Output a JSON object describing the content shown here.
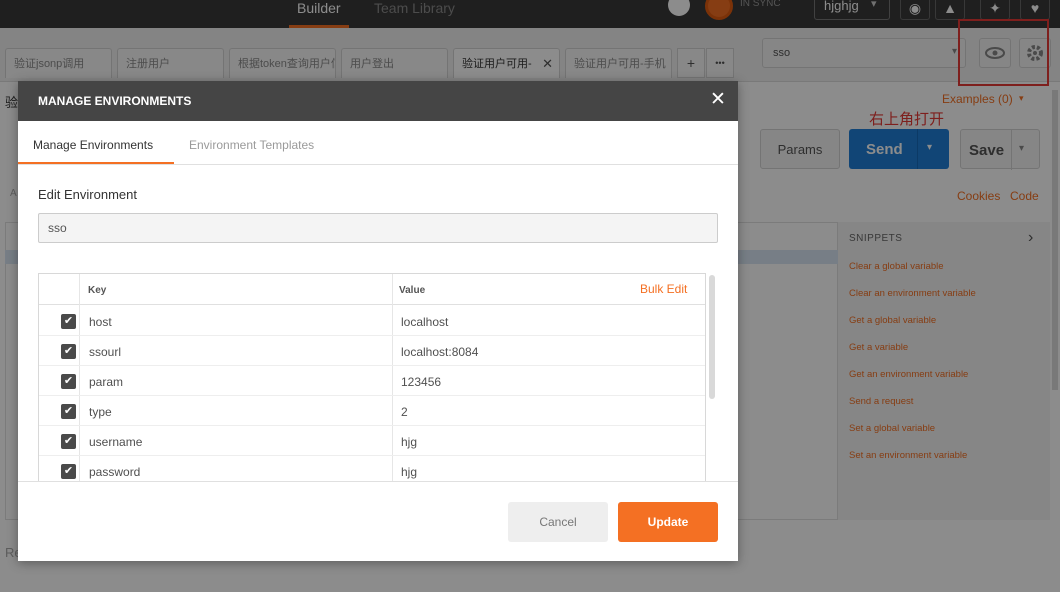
{
  "topbar": {
    "builder_tab": "Builder",
    "team_library_tab": "Team Library",
    "sync_status": "IN SYNC",
    "user_name": "hjghjg",
    "user_caret": "▾"
  },
  "request_tabs": [
    {
      "label": "验证jsonp调用"
    },
    {
      "label": "注册用户"
    },
    {
      "label": "根据token查询用户信息"
    },
    {
      "label": "用户登出"
    },
    {
      "label": "验证用户可用-",
      "close": "✕"
    },
    {
      "label": "验证用户可用-手机"
    }
  ],
  "tab_actions": {
    "add": "+",
    "more": "•••"
  },
  "environment": {
    "selected": "sso",
    "caret": "▾"
  },
  "annotation": "右上角打开",
  "builder": {
    "left_title_fragment": "验",
    "examples": "Examples (0)",
    "examples_caret": "▾",
    "params": "Params",
    "send": "Send",
    "send_caret": "▾",
    "save": "Save",
    "save_caret": "▾",
    "cookies": "Cookies",
    "code": "Code",
    "left_a": "A",
    "left_r": "Re"
  },
  "snippets": {
    "title": "SNIPPETS",
    "chevron": "›",
    "items": [
      "Clear a global variable",
      "Clear an environment variable",
      "Get a global variable",
      "Get a variable",
      "Get an environment variable",
      "Send a request",
      "Set a global variable",
      "Set an environment variable"
    ]
  },
  "modal": {
    "title": "MANAGE ENVIRONMENTS",
    "close": "✕",
    "tabs": {
      "manage": "Manage Environments",
      "templates": "Environment Templates"
    },
    "edit_label": "Edit Environment",
    "env_name": "sso",
    "table": {
      "key_header": "Key",
      "value_header": "Value",
      "bulk_edit": "Bulk Edit",
      "check_glyph": "✔",
      "rows": [
        {
          "key": "host",
          "value": "localhost"
        },
        {
          "key": "ssourl",
          "value": "localhost:8084"
        },
        {
          "key": "param",
          "value": "123456"
        },
        {
          "key": "type",
          "value": "2"
        },
        {
          "key": "username",
          "value": "hjg"
        },
        {
          "key": "password",
          "value": "hjg"
        }
      ]
    },
    "cancel": "Cancel",
    "update": "Update"
  },
  "colors": {
    "accent": "#f47023",
    "send_blue": "#1f7fd8",
    "header_dark": "#454545",
    "annotation_red": "#e53935"
  }
}
